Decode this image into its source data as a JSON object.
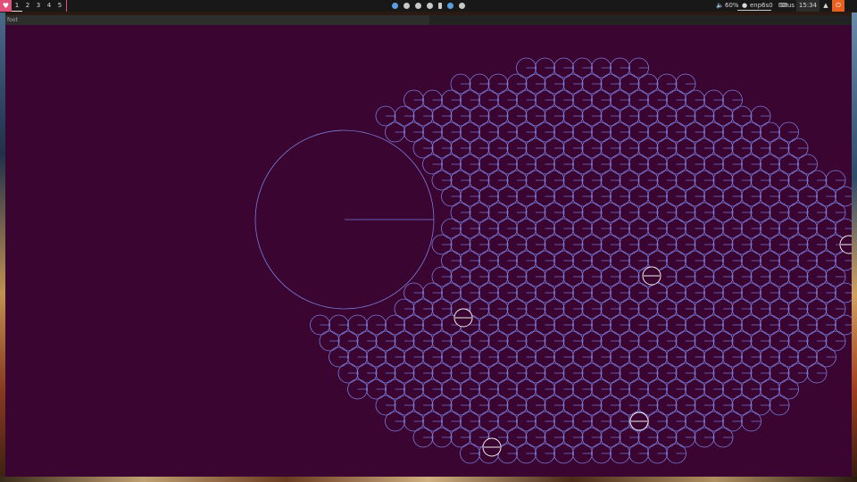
{
  "taskbar": {
    "launcher_icon": "heart-icon",
    "workspaces": [
      {
        "label": "1",
        "active": true
      },
      {
        "label": "2",
        "active": false
      },
      {
        "label": "3",
        "active": false
      },
      {
        "label": "4",
        "active": false
      },
      {
        "label": "5",
        "active": false
      }
    ],
    "tray_icons": [
      "chrome-icon",
      "discord-icon",
      "steam-icon",
      "dropbox-icon",
      "battery-icon",
      "bluetooth-icon",
      "network-icon"
    ],
    "volume": "60%",
    "network_interface": "enp6s0",
    "keyboard_layout": "us",
    "clock": "15:34",
    "notification_icon": "bell-icon",
    "power_icon": "power-icon"
  },
  "window": {
    "title": "foot",
    "background_color": "#3a0530"
  },
  "visualization": {
    "description_colors": {
      "small_circle": "#7a7ad8",
      "highlight_circle": "#f0f0f0",
      "large_circle": "#7a7ad8"
    }
  }
}
